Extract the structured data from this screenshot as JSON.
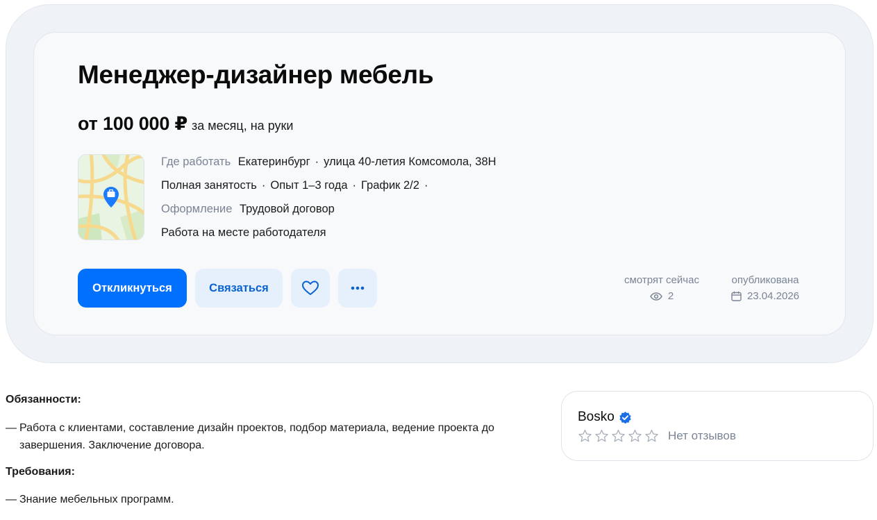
{
  "vacancy": {
    "title": "Менеджер-дизайнер мебель",
    "salary_main": "от 100 000 ₽",
    "salary_sub": "за месяц, на руки",
    "location_label": "Где работать",
    "city": "Екатеринбург",
    "address": "улица 40-летия Комсомола, 38Н",
    "employment": "Полная занятость",
    "experience": "Опыт 1–3 года",
    "schedule": "График 2/2",
    "contract_label": "Оформление",
    "contract": "Трудовой договор",
    "workplace": "Работа на месте работодателя"
  },
  "actions": {
    "apply_label": "Откликнуться",
    "contact_label": "Связаться",
    "favorite_icon": "heart-icon",
    "more_icon": "more-dots-icon"
  },
  "stats": {
    "views_label": "смотрят сейчас",
    "views_value": "2",
    "published_label": "опубликована",
    "published_value": "23.04.2026"
  },
  "description": {
    "responsibilities_title": "Обязанности:",
    "responsibilities_dash": "—",
    "responsibilities_text": "Работа с клиентами, составление дизайн проектов, подбор материала, ведение проекта до завершения. Заключение договора.",
    "requirements_title": "Требования:",
    "requirements_dash": "—",
    "requirements_text": "Знание мебельных программ."
  },
  "employer": {
    "name": "Bosko",
    "verified_icon": "verified-badge-icon",
    "rating_stars": 0,
    "rating_max": 5,
    "reviews_text": "Нет отзывов"
  },
  "colors": {
    "primary": "#0070ff",
    "secondary_bg": "#e6f0fc",
    "muted": "#7b8494",
    "verified": "#1d6fe6"
  }
}
